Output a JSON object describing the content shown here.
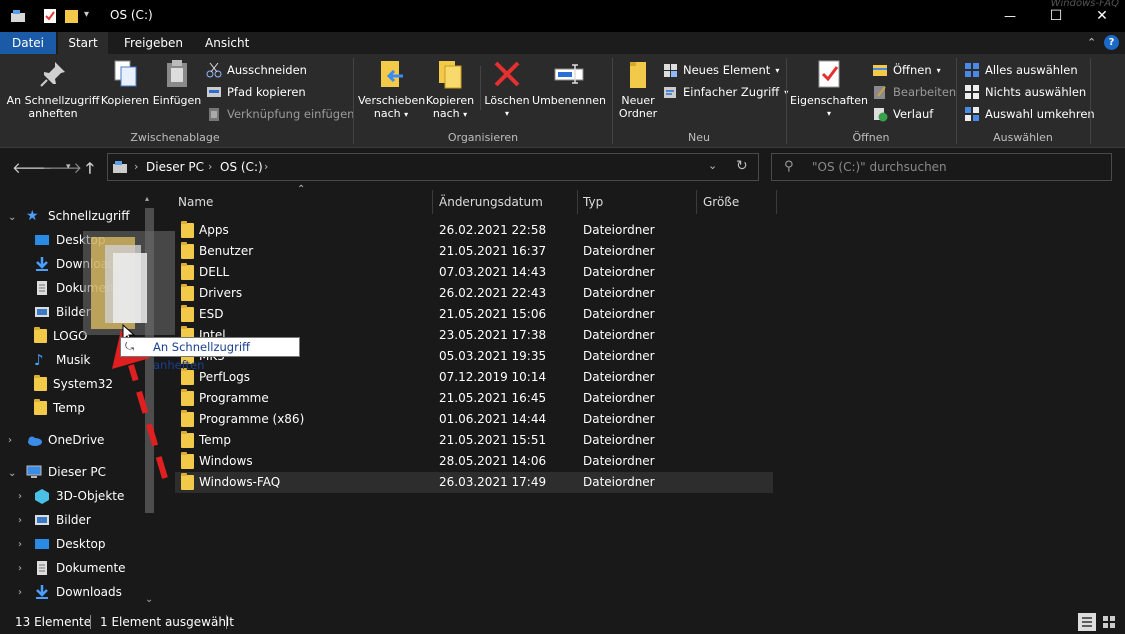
{
  "window": {
    "title": "OS (C:)",
    "watermark": "Windows-FAQ",
    "minimize": "—",
    "maximize": "☐",
    "close": "✕"
  },
  "ribbon_tabs": [
    "Datei",
    "Start",
    "Freigeben",
    "Ansicht"
  ],
  "ribbon": {
    "clipboard": {
      "group_label": "Zwischenablage",
      "pin_line1": "An Schnellzugriff",
      "pin_line2": "anheften",
      "copy": "Kopieren",
      "paste": "Einfügen",
      "cut": "Ausschneiden",
      "copy_path": "Pfad kopieren",
      "paste_shortcut": "Verknüpfung einfügen"
    },
    "organize": {
      "group_label": "Organisieren",
      "move_line1": "Verschieben",
      "move_line2": "nach",
      "copyto_line1": "Kopieren",
      "copyto_line2": "nach",
      "delete": "Löschen",
      "rename": "Umbenennen"
    },
    "new": {
      "group_label": "Neu",
      "new_folder_line1": "Neuer",
      "new_folder_line2": "Ordner",
      "new_item": "Neues Element",
      "easy_access": "Einfacher Zugriff"
    },
    "open": {
      "group_label": "Öffnen",
      "properties": "Eigenschaften",
      "open": "Öffnen",
      "edit": "Bearbeiten",
      "history": "Verlauf"
    },
    "select": {
      "group_label": "Auswählen",
      "select_all": "Alles auswählen",
      "select_none": "Nichts auswählen",
      "invert": "Auswahl umkehren"
    }
  },
  "address": {
    "crumb1": "Dieser PC",
    "crumb2": "OS (C:)",
    "search_placeholder": "\"OS (C:)\" durchsuchen"
  },
  "nav": {
    "quick_access": "Schnellzugriff",
    "quick_items": [
      "Desktop",
      "Downloads",
      "Dokumente",
      "Bilder",
      "LOGO",
      "Musik",
      "System32",
      "Temp"
    ],
    "onedrive": "OneDrive",
    "this_pc": "Dieser PC",
    "pc_items": [
      "3D-Objekte",
      "Bilder",
      "Desktop",
      "Dokumente",
      "Downloads"
    ]
  },
  "columns": {
    "name": "Name",
    "date": "Änderungsdatum",
    "type": "Typ",
    "size": "Größe"
  },
  "files": [
    {
      "name": "Apps",
      "date": "26.02.2021 22:58",
      "type": "Dateiordner"
    },
    {
      "name": "Benutzer",
      "date": "21.05.2021 16:37",
      "type": "Dateiordner"
    },
    {
      "name": "DELL",
      "date": "07.03.2021 14:43",
      "type": "Dateiordner"
    },
    {
      "name": "Drivers",
      "date": "26.02.2021 22:43",
      "type": "Dateiordner"
    },
    {
      "name": "ESD",
      "date": "21.05.2021 15:06",
      "type": "Dateiordner"
    },
    {
      "name": "Intel",
      "date": "23.05.2021 17:38",
      "type": "Dateiordner"
    },
    {
      "name": "MK3",
      "date": "05.03.2021 19:35",
      "type": "Dateiordner"
    },
    {
      "name": "PerfLogs",
      "date": "07.12.2019 10:14",
      "type": "Dateiordner"
    },
    {
      "name": "Programme",
      "date": "21.05.2021 16:45",
      "type": "Dateiordner"
    },
    {
      "name": "Programme (x86)",
      "date": "01.06.2021 14:44",
      "type": "Dateiordner"
    },
    {
      "name": "Temp",
      "date": "21.05.2021 15:51",
      "type": "Dateiordner"
    },
    {
      "name": "Windows",
      "date": "28.05.2021 14:06",
      "type": "Dateiordner"
    },
    {
      "name": "Windows-FAQ",
      "date": "26.03.2021 17:49",
      "type": "Dateiordner"
    }
  ],
  "tooltip": "An Schnellzugriff anheften",
  "status": {
    "count": "13 Elemente",
    "selected": "1 Element ausgewählt"
  },
  "colors": {
    "accent_blue": "#1a5aa6",
    "folder_yellow": "#f3c94a",
    "arrow_red": "#e02020"
  }
}
